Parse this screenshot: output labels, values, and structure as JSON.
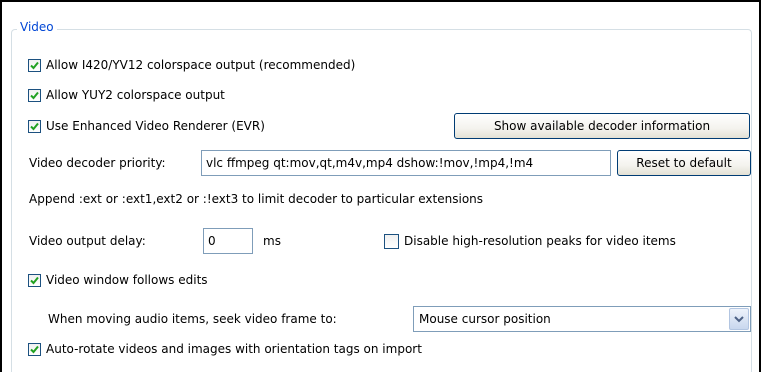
{
  "group": {
    "title": "Video"
  },
  "options": {
    "i420_label": "Allow I420/YV12 colorspace output (recommended)",
    "i420_checked": true,
    "yuy2_label": "Allow YUY2 colorspace output",
    "yuy2_checked": true,
    "evr_label": "Use Enhanced Video Renderer (EVR)",
    "evr_checked": true,
    "hires_peaks_label": "Disable high-resolution peaks for video items",
    "hires_peaks_checked": false,
    "follow_edits_label": "Video window follows edits",
    "follow_edits_checked": true,
    "autorotate_label": "Auto-rotate videos and images with orientation tags on import",
    "autorotate_checked": true
  },
  "buttons": {
    "show_decoder_info": "Show available decoder information",
    "reset_default": "Reset to default"
  },
  "decoder": {
    "label": "Video decoder priority:",
    "value": "vlc ffmpeg qt:mov,qt,m4v,mp4 dshow:!mov,!mp4,!m4",
    "hint": "Append :ext or :ext1,ext2 or :!ext3 to limit decoder to particular extensions"
  },
  "delay": {
    "label": "Video output delay:",
    "value": "0",
    "unit": "ms"
  },
  "seek": {
    "label": "When moving audio items, seek video frame to:",
    "selected": "Mouse cursor position"
  },
  "icons": {
    "check": "checkmark-icon",
    "dropdown": "chevron-down-icon"
  },
  "colors": {
    "group_title": "#0046d5",
    "checkmark": "#21a121"
  }
}
